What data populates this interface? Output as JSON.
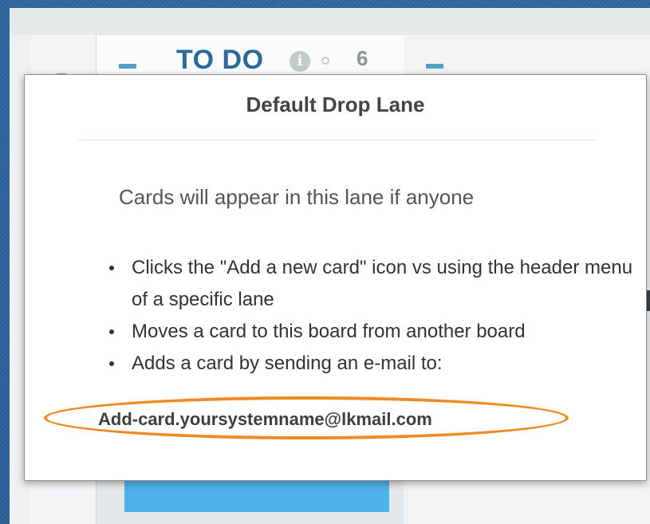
{
  "lane": {
    "title": "TO DO",
    "count": "6",
    "info_icon": "info-icon",
    "status_icon": "circle-icon"
  },
  "popover": {
    "title": "Default Drop Lane",
    "intro": "Cards will appear in this lane if anyone",
    "bullets": [
      "Clicks the \"Add a new card\" icon vs using the header menu of a specific lane",
      "Moves a card to this board from another board",
      "Adds a card by sending an e-mail to:"
    ],
    "email": "Add-card.yoursystemname@lkmail.com"
  },
  "colors": {
    "accent": "#2a6b9a",
    "highlight": "#f08a22",
    "card": "#4fb3ea",
    "background": "#2a5f96"
  }
}
